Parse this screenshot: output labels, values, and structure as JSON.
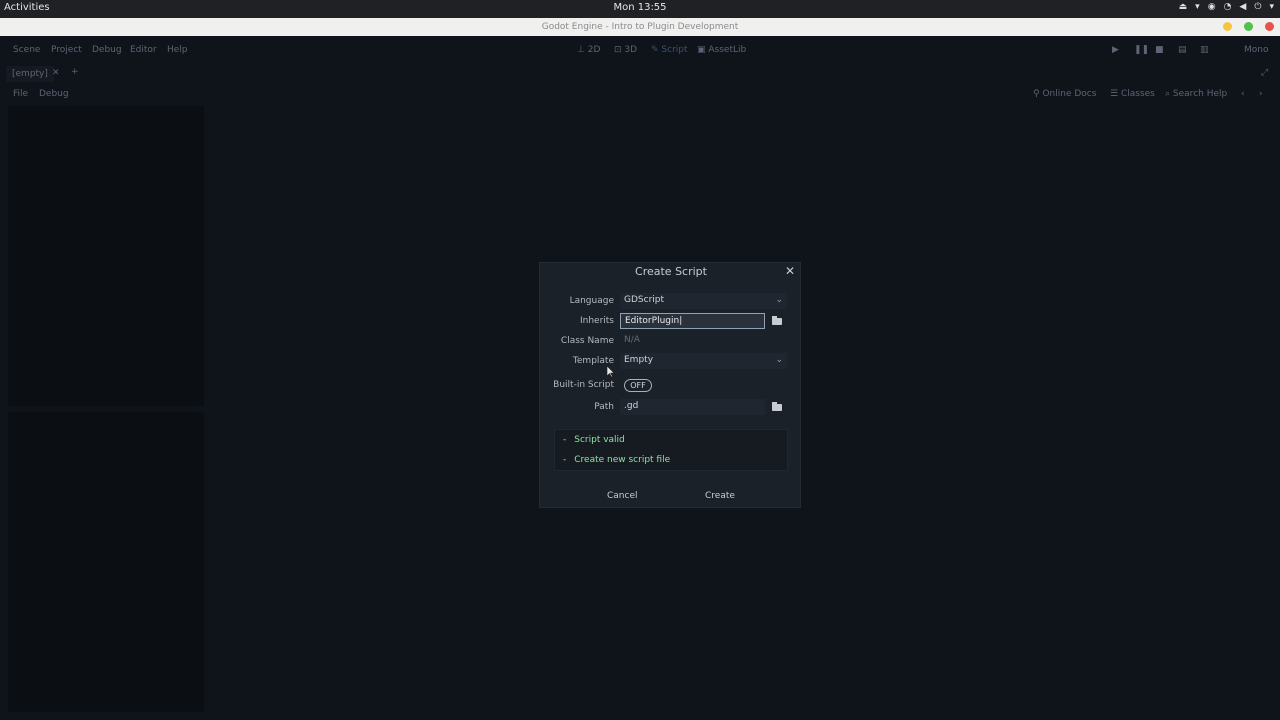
{
  "system": {
    "activities": "Activities",
    "clock": "Mon 13:55"
  },
  "window": {
    "title": "Godot Engine - Intro to Plugin Development"
  },
  "menubar": {
    "items": [
      "Scene",
      "Project",
      "Debug",
      "Editor",
      "Help"
    ],
    "workspaces": [
      "2D",
      "3D",
      "Script",
      "AssetLib"
    ],
    "active_workspace": "Script",
    "mono": "Mono"
  },
  "scene_tabs": {
    "current": "[empty]"
  },
  "script_bar": {
    "file": "File",
    "debug": "Debug",
    "online_docs": "Online Docs",
    "classes": "Classes",
    "search_help": "Search Help"
  },
  "dialog": {
    "title": "Create Script",
    "language_label": "Language",
    "language_value": "GDScript",
    "inherits_label": "Inherits",
    "inherits_value": "EditorPlugin",
    "class_name_label": "Class Name",
    "class_name_value": "N/A",
    "template_label": "Template",
    "template_value": "Empty",
    "builtin_label": "Built-in Script",
    "builtin_toggle": "OFF",
    "path_label": "Path",
    "path_value": ".gd",
    "status_lines": [
      "Script valid",
      "Create new script file"
    ],
    "cancel": "Cancel",
    "create": "Create",
    "status_color": "#8fe39e"
  }
}
